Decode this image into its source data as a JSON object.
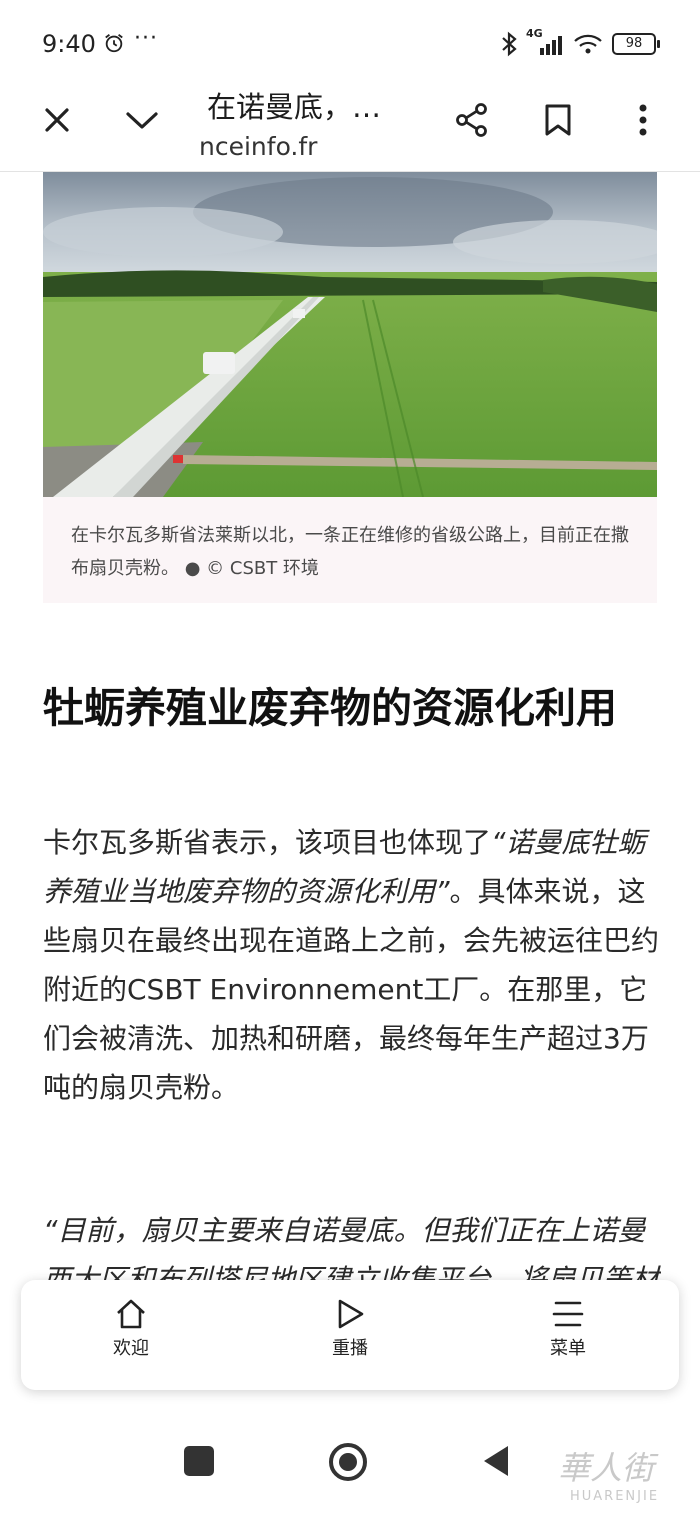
{
  "status_bar": {
    "time": "9:40",
    "more": "···",
    "network": "4G",
    "battery": "98",
    "icons": [
      "alarm-icon",
      "bluetooth-icon",
      "signal-icon",
      "wifi-icon",
      "battery-icon"
    ]
  },
  "toolbar": {
    "title": "在诺曼底，…",
    "url": "nceinfo.fr",
    "icons": [
      "close-icon",
      "chevron-down-icon",
      "share-icon",
      "bookmark-icon",
      "more-vert-icon"
    ]
  },
  "figure": {
    "caption": "在卡尔瓦多斯省法莱斯以北，一条正在维修的省级公路上，目前正在撒布扇贝壳粉。 ● © CSBT 环境"
  },
  "article": {
    "heading": "牡蛎养殖业废弃物的资源化利用",
    "para_start": "卡尔瓦多斯省表示，该项目也体现了",
    "para_quote": "“诺曼底牡蛎养殖业当地废弃物的资源化利用”",
    "para_end": "。具体来说，这些扇贝在最终出现在道路上之前，会先被运往巴约附近的CSBT Environnement工厂。在那里，它们会被清洗、加热和研磨，最终每年生产超过3万吨的扇贝壳粉。",
    "quote": "“目前，扇贝主要来自诺曼底。但我们正在上诺曼西大区和布列塔尼地区建立收集平台，将扇贝等材料运往…该公司的负责人说。"
  },
  "bottom_nav": {
    "items": [
      {
        "label": "欢迎",
        "icon": "home-icon"
      },
      {
        "label": "重播",
        "icon": "play-icon"
      },
      {
        "label": "菜单",
        "icon": "menu-icon"
      }
    ]
  },
  "system_nav": {
    "icons": [
      "recents-square-icon",
      "home-circle-icon",
      "back-triangle-icon"
    ]
  },
  "watermark": {
    "text": "华人街",
    "subtext": "HUARENJIE"
  },
  "colors": {
    "caption_bg": "#fbf5f7",
    "text": "#2a2a2a",
    "heading": "#111111"
  }
}
